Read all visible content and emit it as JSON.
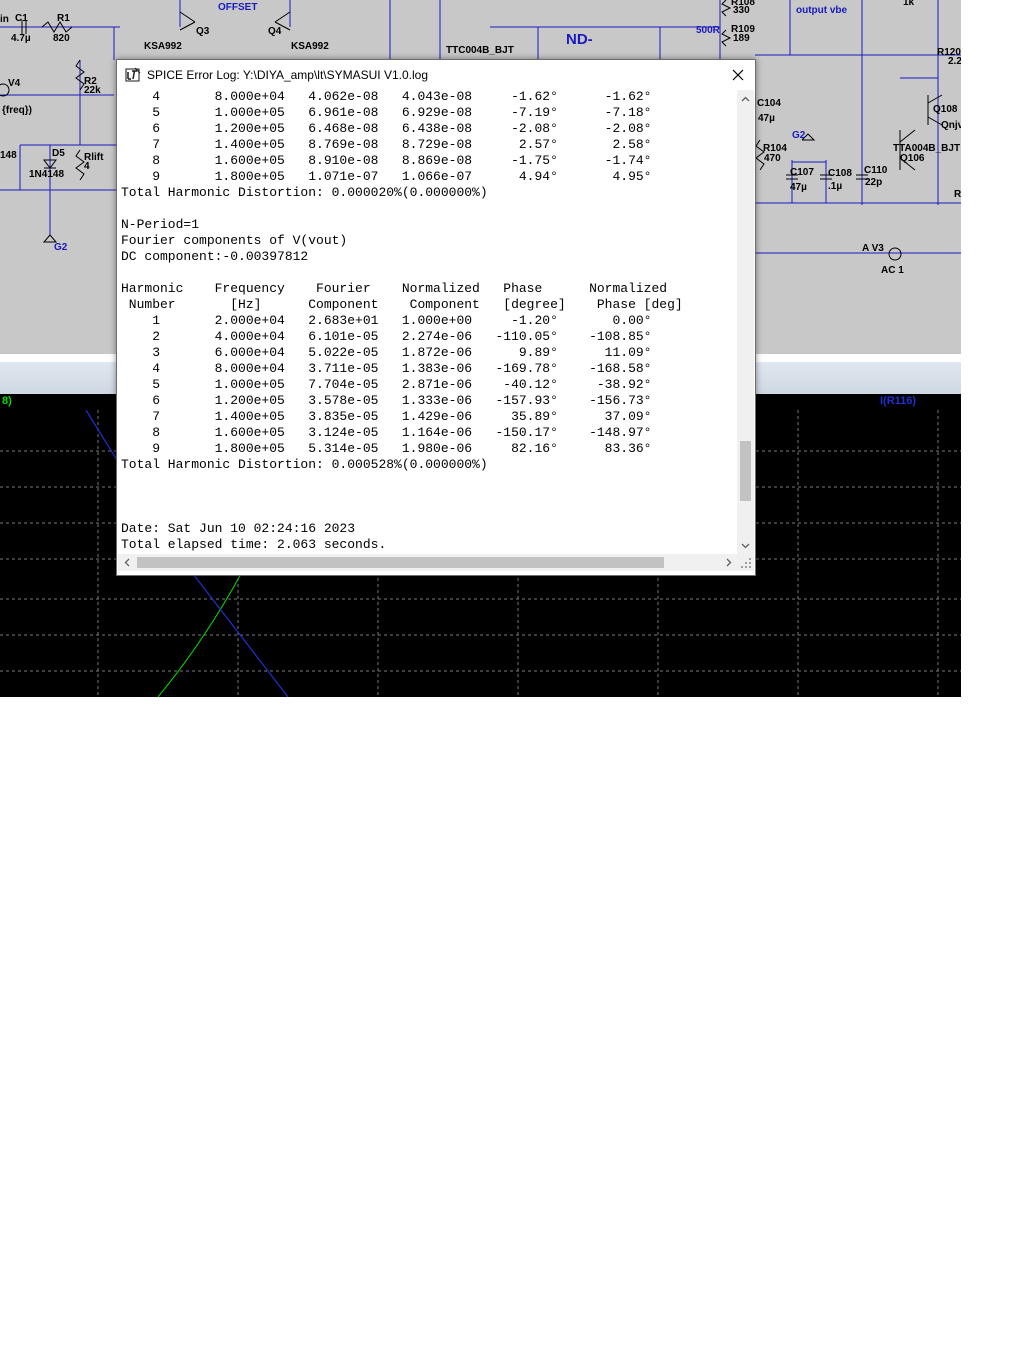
{
  "window": {
    "title": "SPICE Error Log: Y:\\DIYA_amp\\lt\\SYMASUI V1.0.log",
    "app_icon": "ltspice-icon",
    "close_icon": "close-icon"
  },
  "log_lines": [
    "    4       8.000e+04   4.062e-08   4.043e-08     -1.62°      -1.62°",
    "    5       1.000e+05   6.961e-08   6.929e-08     -7.19°      -7.18°",
    "    6       1.200e+05   6.468e-08   6.438e-08     -2.08°      -2.08°",
    "    7       1.400e+05   8.769e-08   8.729e-08      2.57°       2.58°",
    "    8       1.600e+05   8.910e-08   8.869e-08     -1.75°      -1.74°",
    "    9       1.800e+05   1.071e-07   1.066e-07      4.94°       4.95°",
    "Total Harmonic Distortion: 0.000020%(0.000000%)",
    "",
    "N-Period=1",
    "Fourier components of V(vout)",
    "DC component:-0.00397812",
    "",
    "Harmonic    Frequency    Fourier    Normalized   Phase      Normalized",
    " Number       [Hz]      Component    Component   [degree]    Phase [deg]",
    "    1       2.000e+04   2.683e+01   1.000e+00     -1.20°       0.00°",
    "    2       4.000e+04   6.101e-05   2.274e-06   -110.05°    -108.85°",
    "    3       6.000e+04   5.022e-05   1.872e-06      9.89°      11.09°",
    "    4       8.000e+04   3.711e-05   1.383e-06   -169.78°    -168.58°",
    "    5       1.000e+05   7.704e-05   2.871e-06    -40.12°     -38.92°",
    "    6       1.200e+05   3.578e-05   1.333e-06   -157.93°    -156.73°",
    "    7       1.400e+05   3.835e-05   1.429e-06     35.89°      37.09°",
    "    8       1.600e+05   3.124e-05   1.164e-06   -150.17°    -148.97°",
    "    9       1.800e+05   5.314e-05   1.980e-06     82.16°      83.36°",
    "Total Harmonic Distortion: 0.000528%(0.000000%)",
    "",
    "",
    "",
    "Date: Sat Jun 10 02:24:16 2023",
    "Total elapsed time: 2.063 seconds."
  ],
  "schematic_labels": [
    {
      "id": "vin",
      "text": "in"
    },
    {
      "id": "c1",
      "text": "C1"
    },
    {
      "id": "c1v",
      "text": "4.7µ"
    },
    {
      "id": "r1",
      "text": "R1"
    },
    {
      "id": "r1v",
      "text": "820"
    },
    {
      "id": "offset",
      "text": "OFFSET"
    },
    {
      "id": "q3",
      "text": "Q3"
    },
    {
      "id": "ksa1",
      "text": "KSA992"
    },
    {
      "id": "q4",
      "text": "Q4"
    },
    {
      "id": "ksa2",
      "text": "KSA992"
    },
    {
      "id": "ttc",
      "text": "TTC004B_BJT"
    },
    {
      "id": "nd",
      "text": "ND-"
    },
    {
      "id": "r108",
      "text": "R108"
    },
    {
      "id": "r108v",
      "text": "330"
    },
    {
      "id": "r500",
      "text": "500R"
    },
    {
      "id": "r109",
      "text": "R109"
    },
    {
      "id": "r109v",
      "text": "189"
    },
    {
      "id": "outvbe",
      "text": "output vbe"
    },
    {
      "id": "k1",
      "text": "1k"
    },
    {
      "id": "r120",
      "text": "R120"
    },
    {
      "id": "r120v",
      "text": "2.2"
    },
    {
      "id": "v4",
      "text": "V4"
    },
    {
      "id": "freq",
      "text": "{freq})"
    },
    {
      "id": "r2",
      "text": "R2"
    },
    {
      "id": "r2v",
      "text": "22k"
    },
    {
      "id": "c104",
      "text": "C104"
    },
    {
      "id": "c104v",
      "text": "47µ"
    },
    {
      "id": "q108",
      "text": "Q108"
    },
    {
      "id": "qnj",
      "text": "Qnjv"
    },
    {
      "id": "g2a",
      "text": "G2"
    },
    {
      "id": "r104",
      "text": "R104"
    },
    {
      "id": "r104v",
      "text": "470"
    },
    {
      "id": "tta",
      "text": "TTA004B_BJT"
    },
    {
      "id": "q106",
      "text": "Q106"
    },
    {
      "id": "c107",
      "text": "C107"
    },
    {
      "id": "c107v",
      "text": "47µ"
    },
    {
      "id": "c108",
      "text": "C108"
    },
    {
      "id": "c108v",
      "text": ".1µ"
    },
    {
      "id": "c110",
      "text": "C110"
    },
    {
      "id": "c110v",
      "text": "22p"
    },
    {
      "id": "d148",
      "text": "148"
    },
    {
      "id": "d5",
      "text": "D5"
    },
    {
      "id": "rlift",
      "text": "Rlift"
    },
    {
      "id": "rliftv",
      "text": "4"
    },
    {
      "id": "n4148",
      "text": "1N4148"
    },
    {
      "id": "g2b",
      "text": "G2"
    },
    {
      "id": "av3",
      "text": "A V3"
    },
    {
      "id": "ac1",
      "text": "AC 1"
    },
    {
      "id": "redge",
      "text": "R"
    }
  ],
  "traces": {
    "left_label": "8)",
    "right_label": "I(R116)",
    "left_color": "#00e000",
    "right_color": "#2030d0"
  }
}
